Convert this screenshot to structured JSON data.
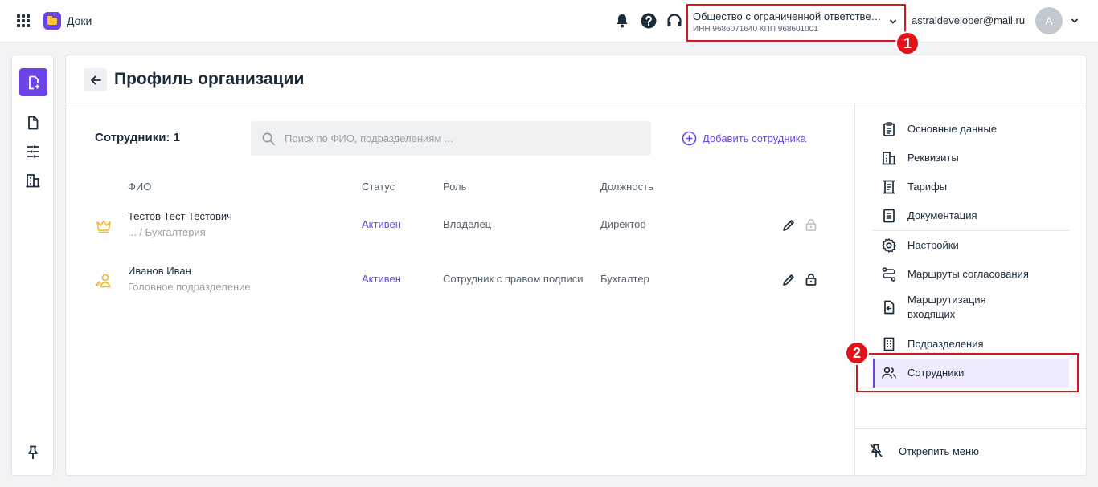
{
  "header": {
    "app_name": "Доки",
    "org": {
      "name": "Общество с ограниченной ответственностью",
      "inn_kpp": "ИНН 9686071640   КПП 968601001"
    },
    "user": {
      "email": "astraldeveloper@mail.ru",
      "avatar_letter": "A"
    },
    "icons": [
      "apps-grid-icon",
      "bell-icon",
      "help-icon",
      "headset-icon",
      "chevron-down-icon"
    ]
  },
  "markers": {
    "first": "1",
    "second": "2"
  },
  "page": {
    "title": "Профиль организации"
  },
  "employees": {
    "count_label": "Сотрудники: 1",
    "search_placeholder": "Поиск по ФИО, подразделениям ...",
    "add_label": "Добавить сотрудника",
    "columns": {
      "name": "ФИО",
      "status": "Статус",
      "role": "Роль",
      "position": "Должность"
    },
    "rows": [
      {
        "icon": "crown-icon",
        "name": "Тестов Тест Тестович",
        "department": "... / Бухгалтерия",
        "status": "Активен",
        "role": "Владелец",
        "position": "Директор",
        "lock_state": "disabled"
      },
      {
        "icon": "user-sign-icon",
        "name": "Иванов Иван",
        "department": "Головное подразделение",
        "status": "Активен",
        "role": "Сотрудник с правом подписи",
        "position": "Бухгалтер",
        "lock_state": "enabled"
      }
    ]
  },
  "menu": {
    "items": [
      {
        "label": "Основные данные",
        "icon": "clipboard-icon"
      },
      {
        "label": "Реквизиты",
        "icon": "building-icon"
      },
      {
        "label": "Тарифы",
        "icon": "tariff-icon"
      },
      {
        "label": "Документация",
        "icon": "document-icon"
      },
      {
        "label": "Настройки",
        "icon": "gear-icon"
      },
      {
        "label": "Маршруты согласования",
        "icon": "route-icon"
      },
      {
        "label": "Маршрутизация входящих",
        "icon": "incoming-route-icon"
      },
      {
        "label": "Подразделения",
        "icon": "departments-icon"
      },
      {
        "label": "Сотрудники",
        "icon": "users-icon",
        "active": true
      }
    ],
    "unpin_label": "Открепить меню"
  },
  "colors": {
    "accent": "#6b43e8",
    "highlight": "#d6171c",
    "marker": "#e3131b",
    "crown": "#f2b824"
  }
}
